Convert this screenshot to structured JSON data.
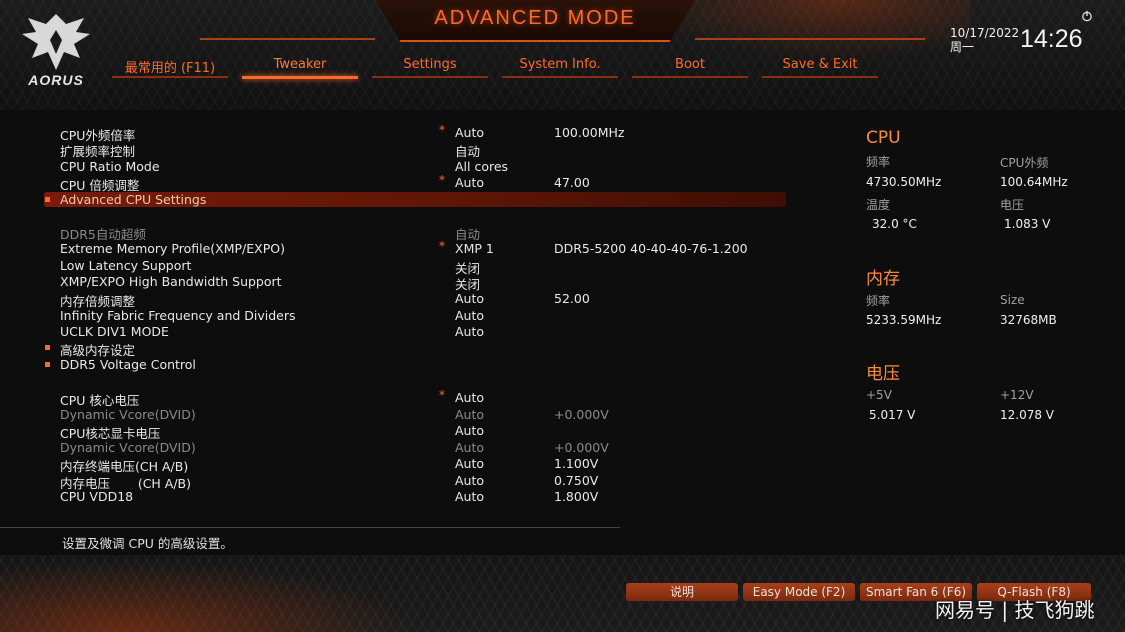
{
  "title": "ADVANCED MODE",
  "logo": {
    "text": "AORUS",
    "icon": "eagle-icon"
  },
  "tabs": [
    {
      "label": "最常用的 (F11)",
      "active": false
    },
    {
      "label": "Tweaker",
      "active": true
    },
    {
      "label": "Settings",
      "active": false
    },
    {
      "label": "System Info.",
      "active": false
    },
    {
      "label": "Boot",
      "active": false
    },
    {
      "label": "Save & Exit",
      "active": false
    }
  ],
  "datetime": {
    "date": "10/17/2022",
    "weekday": "周一",
    "time": "14:26"
  },
  "settings": [
    {
      "label": "CPU外频倍率",
      "star": "*",
      "value": "Auto",
      "value2": "100.00MHz"
    },
    {
      "label": "扩展频率控制",
      "value": "自动"
    },
    {
      "label": "CPU Ratio Mode",
      "value": "All cores"
    },
    {
      "label": "CPU 倍频调整",
      "star": "*",
      "value": "Auto",
      "value2": "47.00"
    },
    {
      "label": "Advanced CPU Settings"
    },
    {
      "label": "DDR5自动超频",
      "value": "自动"
    },
    {
      "label": "Extreme Memory Profile(XMP/EXPO)",
      "star": "*",
      "value": "XMP 1",
      "value2": "DDR5-5200 40-40-40-76-1.200"
    },
    {
      "label": "Low Latency Support",
      "value": "关闭"
    },
    {
      "label": "XMP/EXPO High Bandwidth Support",
      "value": "关闭"
    },
    {
      "label": "内存倍频调整",
      "value": "Auto",
      "value2": "52.00"
    },
    {
      "label": "Infinity Fabric Frequency and Dividers",
      "value": "Auto"
    },
    {
      "label": "UCLK DIV1 MODE",
      "value": "Auto"
    },
    {
      "label": "高级内存设定"
    },
    {
      "label": "DDR5 Voltage Control"
    },
    {
      "label": "CPU 核心电压",
      "star": "*",
      "value": "Auto"
    },
    {
      "label": "Dynamic Vcore(DVID)",
      "value": "Auto",
      "value2": "+0.000V"
    },
    {
      "label": "CPU核芯显卡电压",
      "value": "Auto"
    },
    {
      "label": "Dynamic Vcore(DVID)",
      "value": "Auto",
      "value2": "+0.000V"
    },
    {
      "label": "内存终端电压(CH A/B)",
      "value": "Auto",
      "value2": "1.100V"
    },
    {
      "label": "内存电压       (CH A/B)",
      "value": "Auto",
      "value2": "0.750V"
    },
    {
      "label": "CPU VDD18",
      "value": "Auto",
      "value2": "1.800V"
    }
  ],
  "help_text": "设置及微调 CPU 的高级设置。",
  "cpu": {
    "title": "CPU",
    "freq_label": "频率",
    "freq_value": "4730.50MHz",
    "bclk_label": "CPU外频",
    "bclk_value": "100.64MHz",
    "temp_label": "温度",
    "temp_value": "32.0 °C",
    "volt_label": "电压",
    "volt_value": "1.083 V"
  },
  "memory": {
    "title": "内存",
    "freq_label": "频率",
    "freq_value": "5233.59MHz",
    "size_label": "Size",
    "size_value": "32768MB"
  },
  "voltage": {
    "title": "电压",
    "p5_label": "+5V",
    "p5_value": "5.017 V",
    "p12_label": "+12V",
    "p12_value": "12.078 V"
  },
  "buttons": {
    "help": "说明",
    "easy_mode": "Easy Mode (F2)",
    "smart_fan": "Smart Fan 6 (F6)",
    "qflash": "Q-Flash (F8)"
  },
  "watermark": "网易号 | 技飞狗跳",
  "colors": {
    "accent": "#ff6a2a",
    "highlight": "#7a1c0a",
    "background": "#0d0d0d"
  }
}
